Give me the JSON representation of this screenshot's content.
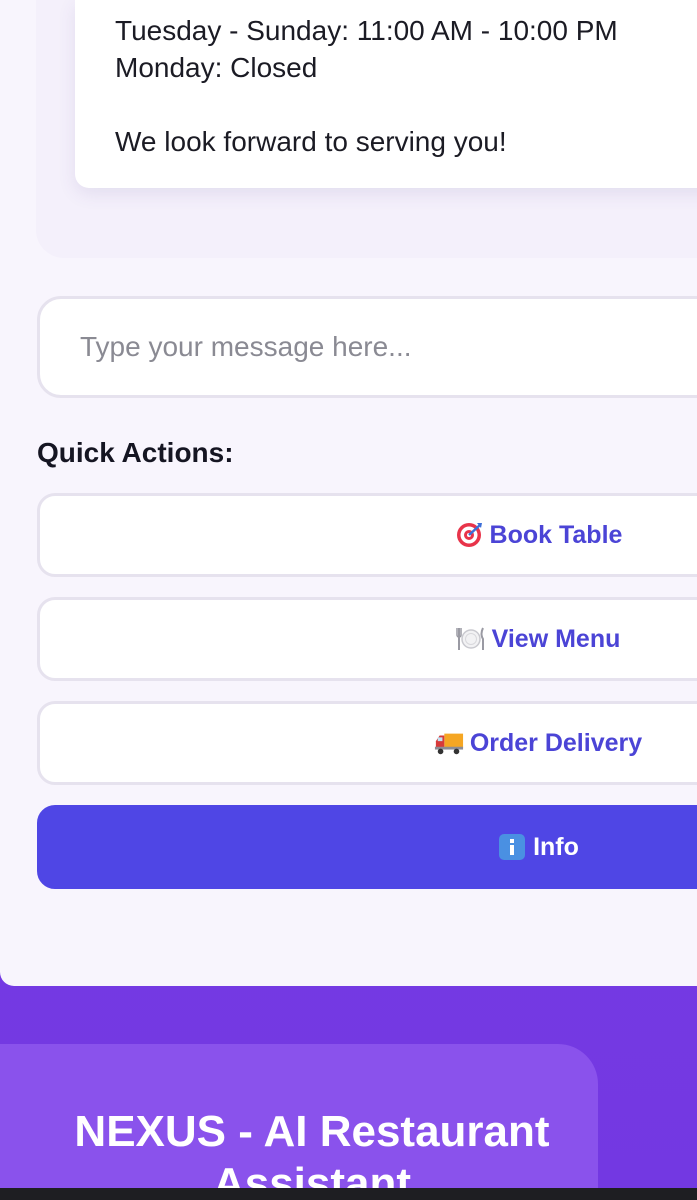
{
  "bot_message": {
    "hours_line": "Tuesday - Sunday: 11:00 AM - 10:00 PM",
    "closed_line": "Monday: Closed",
    "closing_line": "We look forward to serving you!"
  },
  "input": {
    "placeholder": "Type your message here...",
    "value": ""
  },
  "quick_actions": {
    "title": "Quick Actions:",
    "buttons": [
      {
        "icon": "target-icon",
        "label": "Book Table",
        "active": false
      },
      {
        "icon": "plate-cutlery-icon",
        "label": "View Menu",
        "active": false
      },
      {
        "icon": "delivery-truck-icon",
        "label": "Order Delivery",
        "active": false
      },
      {
        "icon": "info-icon",
        "label": "Info",
        "active": true
      }
    ]
  },
  "brand": {
    "title": "NEXUS - AI Restaurant Assistant"
  },
  "colors": {
    "accent": "#4f46e5",
    "accent_text": "#4b44d6",
    "header_purple": "#7a3ee6",
    "panel_bg": "#f8f5fd"
  }
}
